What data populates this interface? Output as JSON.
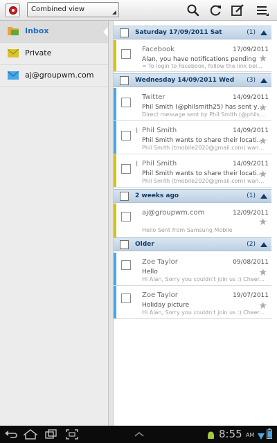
{
  "toolbar": {
    "view_selector": "Combined view",
    "icons": [
      "email-app-icon",
      "search-icon",
      "refresh-icon",
      "compose-icon",
      "menu-icon"
    ]
  },
  "sidebar": {
    "folders": [
      {
        "label": "Inbox",
        "icon": "inbox-folder-icon",
        "selected": true
      },
      {
        "label": "Private",
        "icon": "envelope-yellow-icon",
        "selected": false
      },
      {
        "label": "aj@groupwm.com",
        "icon": "envelope-blue-icon",
        "selected": false
      }
    ]
  },
  "groups": [
    {
      "title": "Saturday  17/09/2011 Sat",
      "count": "(1)"
    },
    {
      "title": "Wednesday  14/09/2011 Wed",
      "count": "(3)"
    },
    {
      "title": "2 weeks ago",
      "count": "(1)"
    },
    {
      "title": "Older",
      "count": "(2)"
    }
  ],
  "messages": [
    {
      "sender": "Facebook",
      "date": "17/09/2011",
      "subject": "Alan, you have notifications pending",
      "preview": "= To login to Facebook, follow the link bel...",
      "account_color": "#d4c21c",
      "attachment": false
    },
    {
      "sender": "Twitter",
      "date": "14/09/2011",
      "subject": "Phil Smith (@philsmith25) has sent yo...",
      "preview": "Direct message sent by Phil Smith (@phils...",
      "account_color": "#4aa6e6",
      "attachment": false
    },
    {
      "sender": "Phil Smith",
      "date": "14/09/2011",
      "subject": "Phil Smith wants to share their locatio...",
      "preview": "Phil Smith (tmobile2020@gmail.com) want...",
      "account_color": "#4aa6e6",
      "attachment": true
    },
    {
      "sender": "Phil Smith",
      "date": "14/09/2011",
      "subject": "Phil Smith wants to share their locatio...",
      "preview": "Phil Smith (tmobile2020@gmail.com) want...",
      "account_color": "#d4c21c",
      "attachment": true
    },
    {
      "sender": "aj@groupwm.com",
      "date": "12/09/2011",
      "subject": "",
      "preview": "Hello Sent from Samsung Mobile",
      "account_color": "#d4c21c",
      "attachment": false
    },
    {
      "sender": "Zoe Taylor",
      "date": "09/08/2011",
      "subject": "Hello",
      "preview": "Hi Alan, Sorry you couldn't join us :) Cheer...",
      "account_color": "#4aa6e6",
      "attachment": false
    },
    {
      "sender": "Zoe Taylor",
      "date": "19/07/2011",
      "subject": "Holiday picture",
      "preview": "Hi Alan, Sorry you couldn't join us :) Cheer...",
      "account_color": "#4aa6e6",
      "attachment": false
    }
  ],
  "status_bar": {
    "time": "8:55",
    "ampm": "AM",
    "icons": [
      "back-icon",
      "home-icon",
      "recent-apps-icon",
      "screenshot-icon",
      "up-arrow-icon",
      "android-icon",
      "wifi-icon",
      "battery-icon"
    ]
  }
}
